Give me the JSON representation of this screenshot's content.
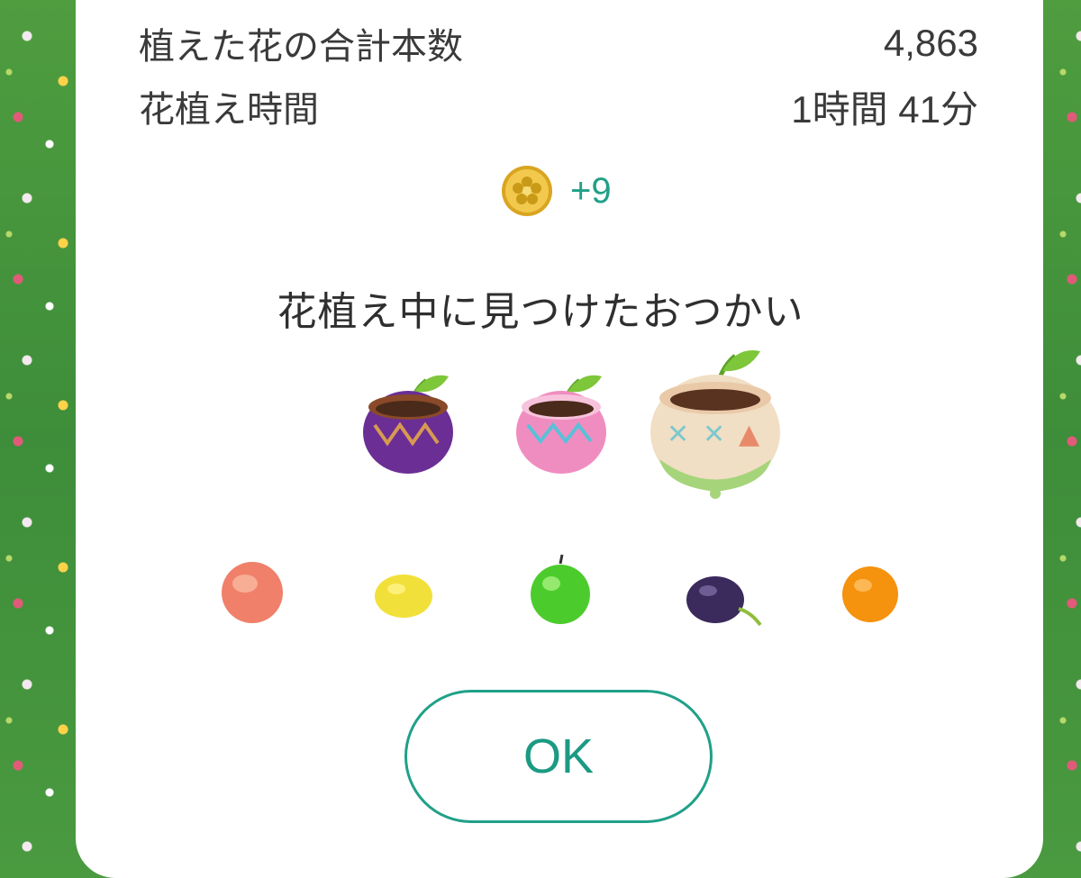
{
  "stats": {
    "total_flowers_label": "植えた花の合計本数",
    "total_flowers_value": "4,863",
    "planting_time_label": "花植え時間",
    "planting_time_value": "1時間 41分"
  },
  "reward": {
    "icon": "flower-coin-icon",
    "amount": "+9"
  },
  "found_section": {
    "title": "花植え中に見つけたおつかい",
    "pots": [
      {
        "name": "purple-sprout-pot",
        "color": "#6b2e95"
      },
      {
        "name": "pink-sprout-pot",
        "color": "#f08dc0"
      },
      {
        "name": "cream-large-sprout-pot",
        "color": "#f0dfc4"
      }
    ],
    "fruits": [
      {
        "name": "peach",
        "color": "#f0806a"
      },
      {
        "name": "lemon",
        "color": "#f2e03a"
      },
      {
        "name": "apple",
        "color": "#4ccc2c"
      },
      {
        "name": "plum",
        "color": "#3b2a5c"
      },
      {
        "name": "orange",
        "color": "#f5920e"
      }
    ]
  },
  "ok_button": {
    "label": "OK"
  },
  "colors": {
    "accent": "#20a088"
  }
}
